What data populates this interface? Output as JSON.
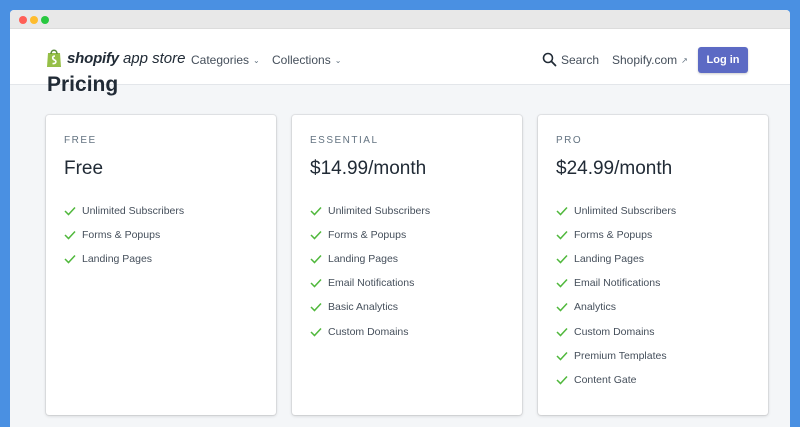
{
  "header": {
    "logo_word": "shopify",
    "logo_sub": "app store",
    "nav": {
      "categories": "Categories",
      "collections": "Collections",
      "search": "Search",
      "shopify_com": "Shopify.com",
      "login": "Log in"
    }
  },
  "page": {
    "title": "Pricing"
  },
  "plans": [
    {
      "tier": "FREE",
      "price": "Free",
      "features": [
        "Unlimited Subscribers",
        "Forms & Popups",
        "Landing Pages"
      ]
    },
    {
      "tier": "ESSENTIAL",
      "price": "$14.99/month",
      "features": [
        "Unlimited Subscribers",
        "Forms & Popups",
        "Landing Pages",
        "Email Notifications",
        "Basic Analytics",
        "Custom Domains"
      ]
    },
    {
      "tier": "PRO",
      "price": "$24.99/month",
      "features": [
        "Unlimited Subscribers",
        "Forms & Popups",
        "Landing Pages",
        "Email Notifications",
        "Analytics",
        "Custom Domains",
        "Premium Templates",
        "Content Gate"
      ]
    }
  ],
  "colors": {
    "accent": "#5c6ac4",
    "check": "#50b83c",
    "frame": "#4a90e2"
  },
  "icons": {
    "logo": "shopify-bag-icon",
    "search": "search-icon",
    "chevron": "chevron-down-icon",
    "external": "external-link-icon",
    "feature": "checkmark-icon"
  }
}
